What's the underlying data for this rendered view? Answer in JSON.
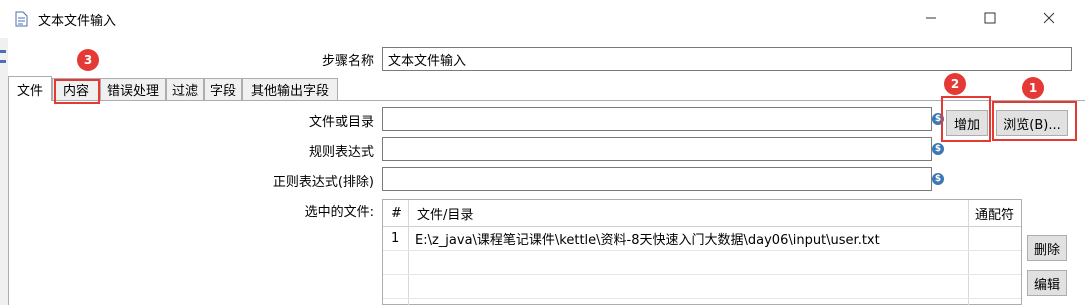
{
  "window": {
    "title": "文本文件输入",
    "minimize_glyph": "—",
    "maximize_glyph": "☐",
    "close_glyph": "✕",
    "icon": "text-file-input-icon"
  },
  "step_name": {
    "label": "步骤名称",
    "value": "文本文件输入"
  },
  "tabs": [
    {
      "label": "文件"
    },
    {
      "label": "内容"
    },
    {
      "label": "错误处理"
    },
    {
      "label": "过滤"
    },
    {
      "label": "字段"
    },
    {
      "label": "其他输出字段"
    }
  ],
  "file_tab": {
    "file_or_dir_label": "文件或目录",
    "file_or_dir_value": "",
    "regex_label": "规则表达式",
    "regex_value": "",
    "regex_exclude_label": "正则表达式(排除)",
    "regex_exclude_value": "",
    "add_button": "增加",
    "browse_button": "浏览(B)...",
    "selected_files_label": "选中的文件:",
    "table": {
      "columns": [
        "#",
        "文件/目录",
        "通配符"
      ],
      "rows": [
        {
          "num": "1",
          "path": "E:\\z_java\\课程笔记课件\\kettle\\资料-8天快速入门大数据\\day06\\input\\user.txt",
          "wildcard": ""
        }
      ]
    },
    "delete_button": "删除",
    "edit_button": "编辑"
  },
  "annotations": {
    "badge_1": "1",
    "badge_2": "2",
    "badge_3": "3",
    "color": "#e53935"
  },
  "colors": {
    "variable_icon": "#3a78b5",
    "button_bg": "#e1e1e1"
  }
}
